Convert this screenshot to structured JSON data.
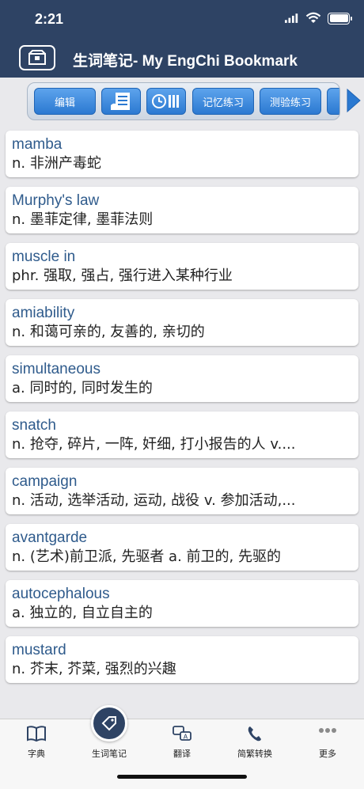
{
  "status": {
    "time": "2:21"
  },
  "header": {
    "title": "生词笔记- My EngChi Bookmark"
  },
  "toolbar": {
    "edit": "编辑",
    "memory_practice": "记忆练习",
    "test_practice": "测验练习"
  },
  "entries": [
    {
      "word": "mamba",
      "def": "n. 非洲产毒蛇"
    },
    {
      "word": "Murphy's law",
      "def": "n. 墨菲定律, 墨菲法则"
    },
    {
      "word": "muscle in",
      "def": "phr. 强取, 强占, 强行进入某种行业"
    },
    {
      "word": "amiability",
      "def": "n. 和蔼可亲的, 友善的, 亲切的"
    },
    {
      "word": "simultaneous",
      "def": "a. 同时的, 同时发生的"
    },
    {
      "word": "snatch",
      "def": "n. 抢夺, 碎片, 一阵, 奸细, 打小报告的人  v...."
    },
    {
      "word": "campaign",
      "def": "n. 活动, 选举活动, 运动, 战役  v. 参加活动,..."
    },
    {
      "word": "avantgarde",
      "def": "n. (艺术)前卫派, 先驱者  a. 前卫的, 先驱的"
    },
    {
      "word": "autocephalous",
      "def": "a. 独立的, 自立自主的"
    },
    {
      "word": "mustard",
      "def": "n. 芥末, 芥菜, 强烈的兴趣"
    }
  ],
  "tabs": {
    "dictionary": "字典",
    "notes": "生词笔记",
    "translate": "翻译",
    "convert": "简繁转换",
    "more": "更多"
  },
  "colors": {
    "header": "#2e4364",
    "accent": "#2b79d1",
    "word": "#2f5b8c"
  }
}
